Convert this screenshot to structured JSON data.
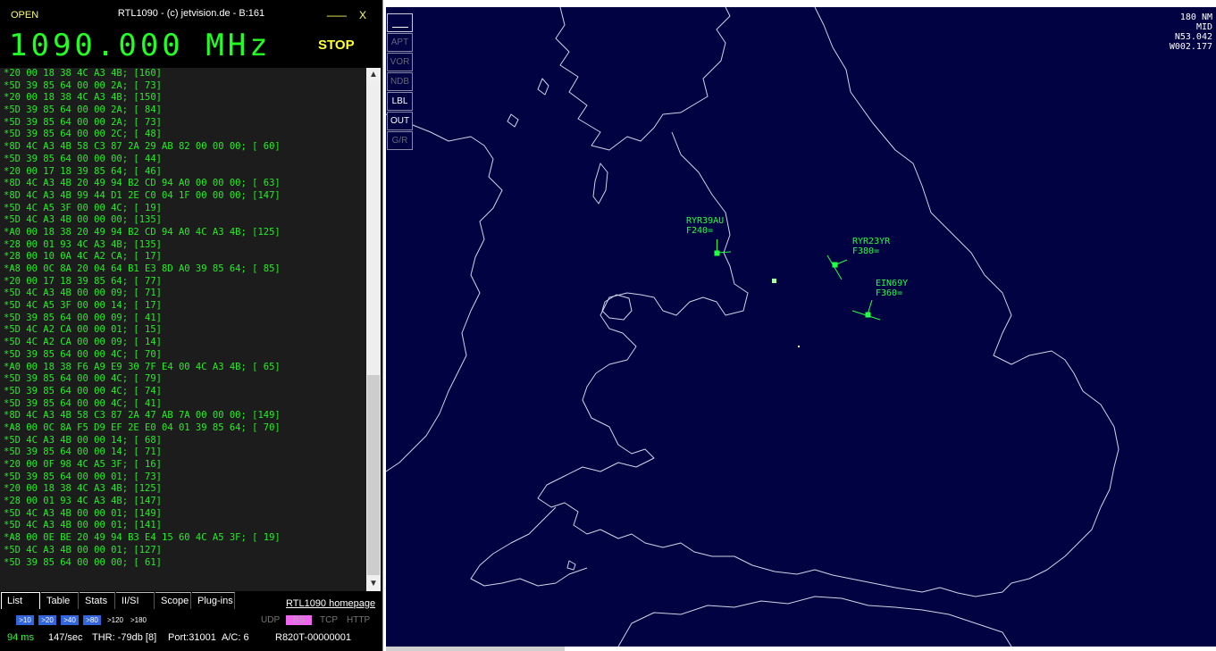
{
  "window": {
    "open_label": "OPEN",
    "title": "RTL1090 - (c) jetvision.de - B:161",
    "minimize_label": "___",
    "close_label": "X"
  },
  "frequency": "1090.000 MHz",
  "stop_label": "STOP",
  "messages": [
    "*20 00 18 38 4C A3 4B; [160]",
    "*5D 39 85 64 00 00 2A; [ 73]",
    "*20 00 18 38 4C A3 4B; [150]",
    "*5D 39 85 64 00 00 2A; [ 84]",
    "*5D 39 85 64 00 00 2A; [ 73]",
    "*5D 39 85 64 00 00 2C; [ 48]",
    "*8D 4C A3 4B 58 C3 87 2A 29 AB 82 00 00 00; [ 60]",
    "*5D 39 85 64 00 00 00; [ 44]",
    "*20 00 17 18 39 85 64; [ 46]",
    "*8D 4C A3 4B 20 49 94 B2 CD 94 A0 00 00 00; [ 63]",
    "*8D 4C A3 4B 99 44 D1 2E C0 04 1F 00 00 00; [147]",
    "*5D 4C A5 3F 00 00 4C; [ 19]",
    "*5D 4C A3 4B 00 00 00; [135]",
    "*A0 00 18 38 20 49 94 B2 CD 94 A0 4C A3 4B; [125]",
    "*28 00 01 93 4C A3 4B; [135]",
    "*28 00 10 0A 4C A2 CA; [ 17]",
    "*A8 00 0C 8A 20 04 64 B1 E3 8D A0 39 85 64; [ 85]",
    "*20 00 17 18 39 85 64; [ 77]",
    "*5D 4C A3 4B 00 00 09; [ 71]",
    "*5D 4C A5 3F 00 00 14; [ 17]",
    "*5D 39 85 64 00 00 09; [ 41]",
    "*5D 4C A2 CA 00 00 01; [ 15]",
    "*5D 4C A2 CA 00 00 09; [ 14]",
    "*5D 39 85 64 00 00 4C; [ 70]",
    "*A0 00 18 38 F6 A9 E9 30 7F E4 00 4C A3 4B; [ 65]",
    "*5D 39 85 64 00 00 4C; [ 79]",
    "*5D 39 85 64 00 00 4C; [ 74]",
    "*5D 39 85 64 00 00 4C; [ 41]",
    "*8D 4C A3 4B 58 C3 87 2A 47 AB 7A 00 00 00; [149]",
    "*A8 00 0C 8A F5 D9 EF 2E E0 04 01 39 85 64; [ 70]",
    "*5D 4C A3 4B 00 00 14; [ 68]",
    "*5D 39 85 64 00 00 14; [ 71]",
    "*20 00 0F 98 4C A5 3F; [ 16]",
    "*5D 39 85 64 00 00 01; [ 73]",
    "*20 00 18 38 4C A3 4B; [125]",
    "*28 00 01 93 4C A3 4B; [147]",
    "*5D 4C A3 4B 00 00 01; [149]",
    "*5D 4C A3 4B 00 00 01; [141]",
    "*A8 00 0E BE 20 49 94 B3 E4 15 60 4C A5 3F; [ 19]",
    "*5D 4C A3 4B 00 00 01; [127]",
    "*5D 39 85 64 00 00 00; [ 61]"
  ],
  "scrollbar": {
    "up": "▲",
    "down": "▼"
  },
  "tabs": [
    "List",
    "Table",
    "Stats",
    "II/SI",
    "Scope",
    "Plug-ins"
  ],
  "homepage_link": "RTL1090 homepage",
  "ranges": [
    ">10",
    ">20",
    ">40",
    ">80",
    ">120",
    ">180"
  ],
  "protocols": {
    "udp": "UDP",
    "bs": "BS",
    "tcp": "TCP",
    "http": "HTTP"
  },
  "status": {
    "ms": "94 ms",
    "rate": "147/sec",
    "threshold": "THR: -79db [8]",
    "port": "Port:31001",
    "ac_count": "A/C: 6",
    "device": "R820T-00000001"
  },
  "map": {
    "layer_buttons": [
      "APT",
      "VOR",
      "NDB",
      "LBL",
      "OUT",
      "G/R"
    ],
    "range": "180 NM",
    "mode": "MID",
    "lat": "N53.042",
    "lon": "W002.177",
    "aircraft": [
      {
        "callsign": "RYR39AU",
        "level": "F240="
      },
      {
        "callsign": "RYR23YR",
        "level": "F380="
      },
      {
        "callsign": "EIN69Y",
        "level": "F360="
      }
    ]
  },
  "colors": {
    "map_background": "#010241",
    "coastline": "#cfd4e6",
    "aircraft": "#22ff44",
    "message_text": "#22ee22",
    "frequency": "#22ff22",
    "stop": "#ffff33"
  }
}
